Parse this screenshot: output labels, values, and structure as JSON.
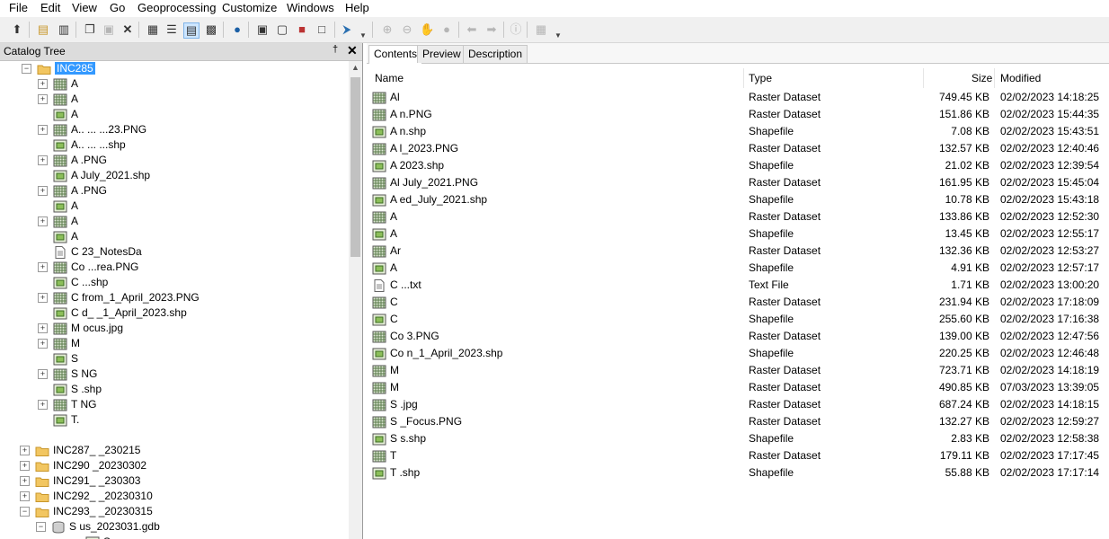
{
  "menu": [
    "File",
    "Edit",
    "View",
    "Go",
    "Geoprocessing",
    "Customize",
    "Windows",
    "Help"
  ],
  "catalog": {
    "title": "Catalog Tree",
    "pin_glyph": "†",
    "close_glyph": "✕",
    "rows": [
      {
        "label": "INC285",
        "icon": "folder-icon",
        "expander": "−",
        "selected": true
      },
      {
        "label": "A",
        "icon": "raster-icon",
        "expander": "+"
      },
      {
        "label": "A",
        "icon": "raster-icon",
        "expander": "+"
      },
      {
        "label": "A",
        "icon": "shapefile-icon",
        "expander": ""
      },
      {
        "label": "A.. ... ...23.PNG",
        "icon": "raster-icon",
        "expander": "+"
      },
      {
        "label": "A.. ... ...shp",
        "icon": "shapefile-icon",
        "expander": ""
      },
      {
        "label": "A .PNG",
        "icon": "raster-icon",
        "expander": "+"
      },
      {
        "label": "A July_2021.shp",
        "icon": "shapefile-icon",
        "expander": ""
      },
      {
        "label": "A .PNG",
        "icon": "raster-icon",
        "expander": "+"
      },
      {
        "label": "A",
        "icon": "shapefile-icon",
        "expander": ""
      },
      {
        "label": "A",
        "icon": "raster-icon",
        "expander": "+"
      },
      {
        "label": "A",
        "icon": "shapefile-icon",
        "expander": ""
      },
      {
        "label": "C 23_NotesDa",
        "icon": "text-file-icon",
        "expander": ""
      },
      {
        "label": "Co ...rea.PNG",
        "icon": "raster-icon",
        "expander": "+"
      },
      {
        "label": "C ...shp",
        "icon": "shapefile-icon",
        "expander": ""
      },
      {
        "label": "C from_1_April_2023.PNG",
        "icon": "raster-icon",
        "expander": "+"
      },
      {
        "label": "C d_ _1_April_2023.shp",
        "icon": "shapefile-icon",
        "expander": ""
      },
      {
        "label": "M ocus.jpg",
        "icon": "raster-icon",
        "expander": "+"
      },
      {
        "label": "M",
        "icon": "raster-icon",
        "expander": "+"
      },
      {
        "label": "S",
        "icon": "shapefile-icon",
        "expander": ""
      },
      {
        "label": "S NG",
        "icon": "raster-icon",
        "expander": "+"
      },
      {
        "label": "S .shp",
        "icon": "shapefile-icon",
        "expander": ""
      },
      {
        "label": "T NG",
        "icon": "raster-icon",
        "expander": "+"
      },
      {
        "label": "T.",
        "icon": "shapefile-icon",
        "expander": ""
      },
      {
        "label": "",
        "icon": "",
        "expander": ""
      },
      {
        "label": "INC287_ _230215",
        "icon": "folder-icon",
        "expander": "+"
      },
      {
        "label": "INC290 _20230302",
        "icon": "folder-icon",
        "expander": "+"
      },
      {
        "label": "INC291_ _230303",
        "icon": "folder-icon",
        "expander": "+"
      },
      {
        "label": "INC292_ _20230310",
        "icon": "folder-icon",
        "expander": "+"
      },
      {
        "label": "INC293_ _20230315",
        "icon": "folder-icon",
        "expander": "−"
      },
      {
        "label": "S us_2023031.gdb",
        "icon": "geodatabase-icon",
        "expander": "−"
      },
      {
        "label": "S us",
        "icon": "shapefile-icon",
        "expander": ""
      }
    ]
  },
  "contents": {
    "tabs": [
      "Contents",
      "Preview",
      "Description"
    ],
    "columns": [
      "Name",
      "Type",
      "Size",
      "Modified"
    ],
    "rows": [
      {
        "name": "Al",
        "icon": "raster-icon",
        "type": "Raster Dataset",
        "size": "749.45 KB",
        "modified": "02/02/2023 14:18:25"
      },
      {
        "name": "A n.PNG",
        "icon": "raster-icon",
        "type": "Raster Dataset",
        "size": "151.86 KB",
        "modified": "02/02/2023 15:44:35"
      },
      {
        "name": "A n.shp",
        "icon": "shapefile-icon",
        "type": "Shapefile",
        "size": "7.08 KB",
        "modified": "02/02/2023 15:43:51"
      },
      {
        "name": "A l_2023.PNG",
        "icon": "raster-icon",
        "type": "Raster Dataset",
        "size": "132.57 KB",
        "modified": "02/02/2023 12:40:46"
      },
      {
        "name": "A 2023.shp",
        "icon": "shapefile-icon",
        "type": "Shapefile",
        "size": "21.02 KB",
        "modified": "02/02/2023 12:39:54"
      },
      {
        "name": "Al July_2021.PNG",
        "icon": "raster-icon",
        "type": "Raster Dataset",
        "size": "161.95 KB",
        "modified": "02/02/2023 15:45:04"
      },
      {
        "name": "A ed_July_2021.shp",
        "icon": "shapefile-icon",
        "type": "Shapefile",
        "size": "10.78 KB",
        "modified": "02/02/2023 15:43:18"
      },
      {
        "name": "A",
        "icon": "raster-icon",
        "type": "Raster Dataset",
        "size": "133.86 KB",
        "modified": "02/02/2023 12:52:30"
      },
      {
        "name": "A",
        "icon": "shapefile-icon",
        "type": "Shapefile",
        "size": "13.45 KB",
        "modified": "02/02/2023 12:55:17"
      },
      {
        "name": "Ar",
        "icon": "raster-icon",
        "type": "Raster Dataset",
        "size": "132.36 KB",
        "modified": "02/02/2023 12:53:27"
      },
      {
        "name": "A",
        "icon": "shapefile-icon",
        "type": "Shapefile",
        "size": "4.91 KB",
        "modified": "02/02/2023 12:57:17"
      },
      {
        "name": "C ...txt",
        "icon": "text-file-icon",
        "type": "Text File",
        "size": "1.71 KB",
        "modified": "02/02/2023 13:00:20"
      },
      {
        "name": "C",
        "icon": "raster-icon",
        "type": "Raster Dataset",
        "size": "231.94 KB",
        "modified": "02/02/2023 17:18:09"
      },
      {
        "name": "C",
        "icon": "shapefile-icon",
        "type": "Shapefile",
        "size": "255.60 KB",
        "modified": "02/02/2023 17:16:38"
      },
      {
        "name": "Co 3.PNG",
        "icon": "raster-icon",
        "type": "Raster Dataset",
        "size": "139.00 KB",
        "modified": "02/02/2023 12:47:56"
      },
      {
        "name": "Co n_1_April_2023.shp",
        "icon": "shapefile-icon",
        "type": "Shapefile",
        "size": "220.25 KB",
        "modified": "02/02/2023 12:46:48"
      },
      {
        "name": "M",
        "icon": "raster-icon",
        "type": "Raster Dataset",
        "size": "723.71 KB",
        "modified": "02/02/2023 14:18:19"
      },
      {
        "name": "M",
        "icon": "raster-icon",
        "type": "Raster Dataset",
        "size": "490.85 KB",
        "modified": "07/03/2023 13:39:05"
      },
      {
        "name": "S .jpg",
        "icon": "raster-icon",
        "type": "Raster Dataset",
        "size": "687.24 KB",
        "modified": "02/02/2023 14:18:15"
      },
      {
        "name": "S _Focus.PNG",
        "icon": "raster-icon",
        "type": "Raster Dataset",
        "size": "132.27 KB",
        "modified": "02/02/2023 12:59:27"
      },
      {
        "name": "S s.shp",
        "icon": "shapefile-icon",
        "type": "Shapefile",
        "size": "2.83 KB",
        "modified": "02/02/2023 12:58:38"
      },
      {
        "name": "T",
        "icon": "raster-icon",
        "type": "Raster Dataset",
        "size": "179.11 KB",
        "modified": "02/02/2023 17:17:45"
      },
      {
        "name": "T .shp",
        "icon": "shapefile-icon",
        "type": "Shapefile",
        "size": "55.88 KB",
        "modified": "02/02/2023 17:17:14"
      }
    ]
  },
  "colors": {
    "selection": "#3399ff",
    "folder": "#e8b94a",
    "raster": "#4f8a3c",
    "shapefile": "#6a9a3c"
  }
}
